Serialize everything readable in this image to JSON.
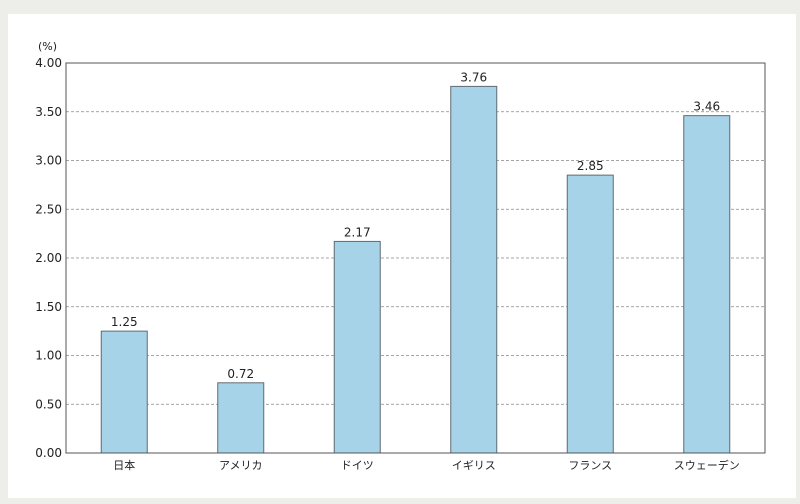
{
  "colors": {
    "bar_fill": "#a7d3e8",
    "bar_stroke": "#5f6b73",
    "grid": "#888888",
    "axis": "#555555"
  },
  "chart_data": {
    "type": "bar",
    "unit_label": "(%)",
    "categories": [
      "日本",
      "アメリカ",
      "ドイツ",
      "イギリス",
      "フランス",
      "スウェーデン"
    ],
    "values": [
      1.25,
      0.72,
      2.17,
      3.76,
      2.85,
      3.46
    ],
    "value_labels": [
      "1.25",
      "0.72",
      "2.17",
      "3.76",
      "2.85",
      "3.46"
    ],
    "yticks": [
      "0.00",
      "0.50",
      "1.00",
      "1.50",
      "2.00",
      "2.50",
      "3.00",
      "3.50",
      "4.00"
    ],
    "ylim": [
      0,
      4
    ],
    "grid": true,
    "legend": "none"
  }
}
